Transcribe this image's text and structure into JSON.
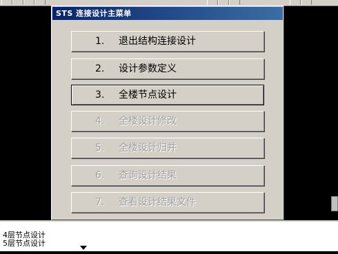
{
  "dialog": {
    "title": "STS 连接设计主菜单",
    "items": [
      {
        "num": "1.",
        "label": "退出结构连接设计",
        "state": "enabled"
      },
      {
        "num": "2.",
        "label": "设计参数定义",
        "state": "enabled"
      },
      {
        "num": "3.",
        "label": "全楼节点设计",
        "state": "selected"
      },
      {
        "num": "4.",
        "label": "全楼设计修改",
        "state": "disabled"
      },
      {
        "num": "5.",
        "label": "全楼设计归并",
        "state": "disabled"
      },
      {
        "num": "6.",
        "label": "查询设计结果",
        "state": "disabled"
      },
      {
        "num": "7.",
        "label": "查看设计结果文件",
        "state": "disabled"
      }
    ]
  },
  "command": {
    "lines": [
      "4层节点设计",
      "5层节点设计"
    ]
  }
}
